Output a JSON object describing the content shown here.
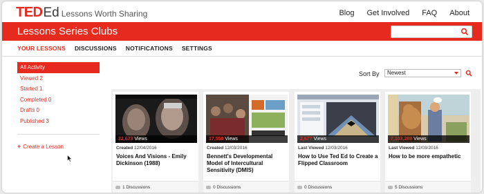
{
  "header": {
    "logo_ted": "TED",
    "logo_ed": "Ed",
    "logo_tagline": "Lessons Worth Sharing",
    "nav": [
      "Blog",
      "Get Involved",
      "FAQ",
      "About"
    ]
  },
  "banner": {
    "title": "Lessons Series Clubs",
    "search_value": "",
    "search_icon": "magnifier"
  },
  "tabs": [
    "YOUR LESSONS",
    "DISCUSSIONS",
    "NOTIFICATIONS",
    "SETTINGS"
  ],
  "active_tab": "YOUR LESSONS",
  "sidebar": {
    "items": [
      "All Activity",
      "Viewed 2",
      "Started 1",
      "Completed 0",
      "Drafts 0",
      "Published 3"
    ],
    "active": "All Activity",
    "create_label": "Create a Lesson"
  },
  "sort": {
    "label": "Sort By",
    "selected": "Newest"
  },
  "cards": [
    {
      "views_number": "32,673",
      "views_label": "Views",
      "meta_label": "Created",
      "date": "12/04/2016",
      "title": "Voices And Visions - Emily Dickinson (1988)",
      "discussions": "1 Discussions"
    },
    {
      "views_number": "17,550",
      "views_label": "Views",
      "meta_label": "Created",
      "date": "12/03/2016",
      "title": "Bennett's Developmental Model of Intercultural Sensitivity (DMIS)",
      "discussions": "0 Discussions"
    },
    {
      "views_number": "2,677",
      "views_label": "Views",
      "meta_label": "Last Viewed",
      "date": "12/03/2016",
      "title": "How to Use Ted Ed to Create a Flipped Classroom",
      "discussions": "0 Discussions"
    },
    {
      "views_number": "7,103,289",
      "views_label": "Views",
      "meta_label": "Last Viewed",
      "date": "12/03/2016",
      "title": "How to be more empathetic",
      "discussions": "5 Discussions"
    }
  ],
  "colors": {
    "brand_red": "#e62b1e",
    "grid_background": "#eeeeee"
  }
}
